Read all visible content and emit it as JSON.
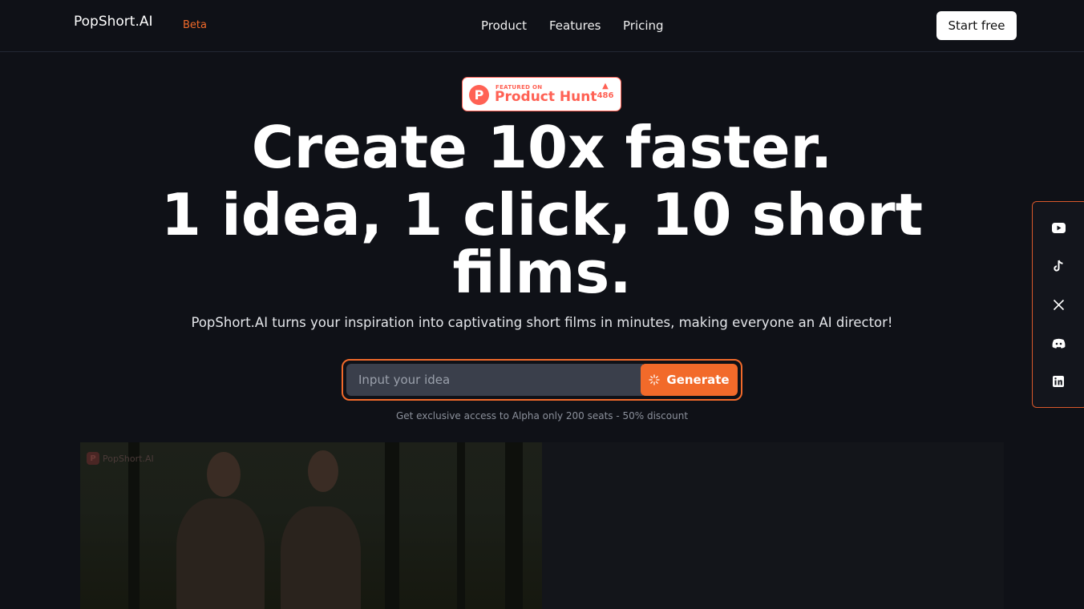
{
  "header": {
    "logo_alt": "PopShort.AI",
    "beta": "Beta",
    "nav": [
      "Product",
      "Features",
      "Pricing"
    ],
    "start_label": "Start free"
  },
  "product_hunt": {
    "small": "FEATURED ON",
    "big": "Product Hunt",
    "count": "486"
  },
  "hero": {
    "line1": "Create 10x faster.",
    "line2": "1 idea, 1 click, 10 short",
    "line3": "films.",
    "subtitle": "PopShort.AI turns your inspiration into captivating short films in minutes, making everyone an AI director!"
  },
  "idea": {
    "placeholder": "Input your idea",
    "generate_label": "Generate",
    "note": "Get exclusive access to Alpha only 200 seats - 50% discount"
  },
  "video": {
    "watermark": "PopShort.AI"
  },
  "social": [
    "youtube-icon",
    "tiktok-icon",
    "x-icon",
    "discord-icon",
    "linkedin-icon"
  ],
  "colors": {
    "accent": "#f26a2a",
    "background": "#0f1117",
    "product_hunt": "#ff6154"
  }
}
